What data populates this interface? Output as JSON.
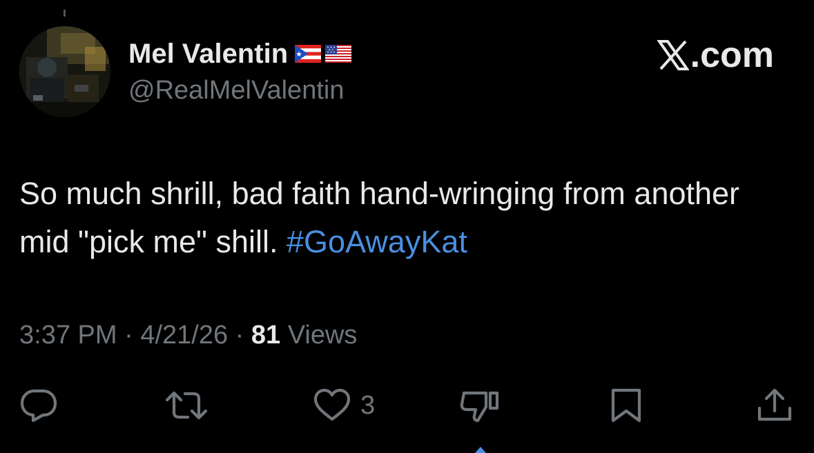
{
  "author": {
    "display_name": "Mel Valentin",
    "flags": [
      "puerto-rico-flag",
      "usa-flag"
    ],
    "handle": "@RealMelValentin",
    "avatar": "avatar-photo"
  },
  "brand": {
    "label": ".com",
    "icon": "x-logo-icon"
  },
  "tweet": {
    "text_main": "So much shrill, bad faith hand-wringing from another mid \"pick me\" shill. ",
    "hashtag": "#GoAwayKat"
  },
  "meta": {
    "time": "3:37 PM",
    "sep1": " · ",
    "date": "4/21/26",
    "sep2": " · ",
    "views_count": "81",
    "views_label": " Views"
  },
  "actions": {
    "reply": {
      "icon": "reply-icon"
    },
    "retweet": {
      "icon": "retweet-icon"
    },
    "like": {
      "icon": "heart-icon",
      "count": "3"
    },
    "dislike": {
      "icon": "thumbs-down-icon"
    },
    "bookmark": {
      "icon": "bookmark-icon"
    },
    "share": {
      "icon": "share-icon"
    }
  },
  "colors": {
    "background": "#000000",
    "text_primary": "#e7e9ea",
    "text_secondary": "#71767b",
    "link": "#4a8fe0"
  }
}
